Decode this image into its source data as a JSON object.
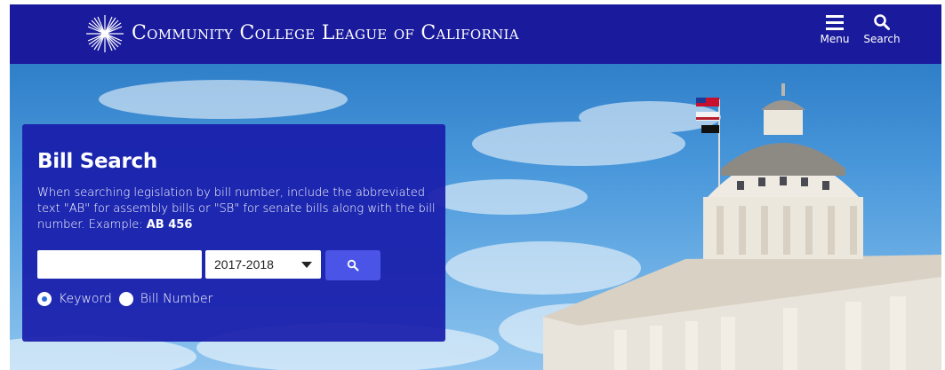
{
  "header": {
    "brand": "Community College League of California",
    "menu_label": "Menu",
    "search_label": "Search"
  },
  "bill_search": {
    "title": "Bill Search",
    "description_prefix": "When searching legislation by bill number, include the abbreviated text \"AB\" for assembly bills or \"SB\" for senate bills along with the bill number. Example: ",
    "example": "AB 456",
    "query_value": "",
    "session": "2017-2018",
    "search_type": {
      "options": [
        "Keyword",
        "Bill Number"
      ],
      "selected": "Keyword"
    }
  },
  "colors": {
    "header_bg": "#1a1a9c",
    "panel_bg": "#181caa",
    "button_bg": "#4a55e8"
  },
  "icons": [
    "sunburst-logo-icon",
    "hamburger-menu-icon",
    "search-icon"
  ]
}
